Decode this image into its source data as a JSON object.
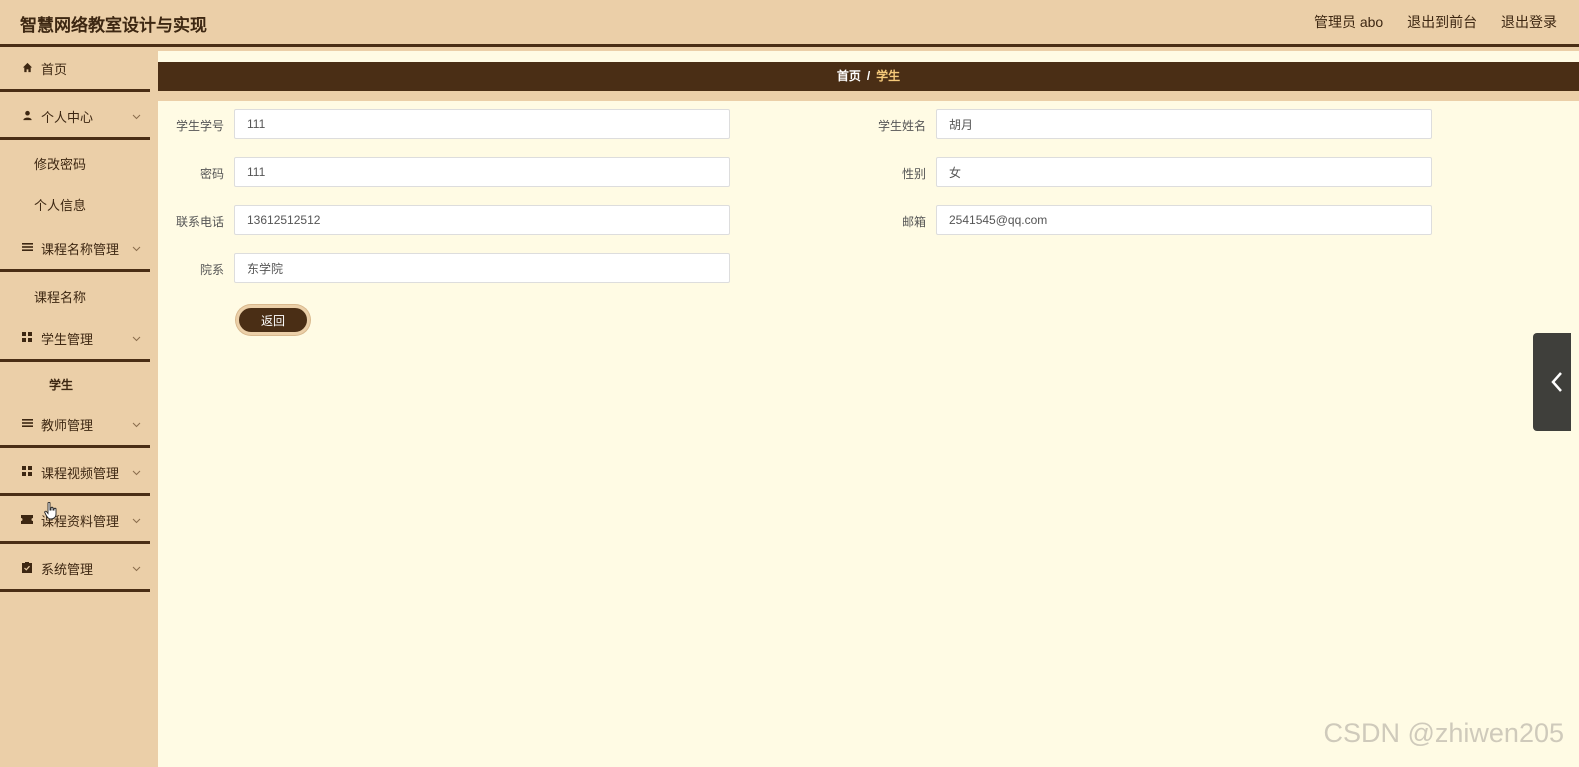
{
  "header": {
    "title": "智慧网络教室设计与实现",
    "admin_label": "管理员 abo",
    "to_front": "退出到前台",
    "logout": "退出登录"
  },
  "sidebar": {
    "home": "首页",
    "personal_center": "个人中心",
    "change_password": "修改密码",
    "personal_info": "个人信息",
    "course_name_mgmt": "课程名称管理",
    "course_name": "课程名称",
    "student_mgmt": "学生管理",
    "student": "学生",
    "teacher_mgmt": "教师管理",
    "course_video_mgmt": "课程视频管理",
    "course_material_mgmt": "课程资料管理",
    "system_mgmt": "系统管理"
  },
  "breadcrumb": {
    "home": "首页",
    "separator": "/",
    "current": "学生"
  },
  "form": {
    "student_id_label": "学生学号",
    "student_id_value": "111",
    "student_name_label": "学生姓名",
    "student_name_value": "胡月",
    "password_label": "密码",
    "password_value": "111",
    "gender_label": "性别",
    "gender_value": "女",
    "phone_label": "联系电话",
    "phone_value": "13612512512",
    "email_label": "邮箱",
    "email_value": "2541545@qq.com",
    "department_label": "院系",
    "department_value": "东学院",
    "back_button": "返回"
  },
  "watermark": "CSDN @zhiwen205",
  "colors": {
    "header_bg": "#ebcfa8",
    "accent_dark": "#4a2e15",
    "content_bg": "#fffbe4",
    "breadcrumb_current": "#f5c97a"
  }
}
